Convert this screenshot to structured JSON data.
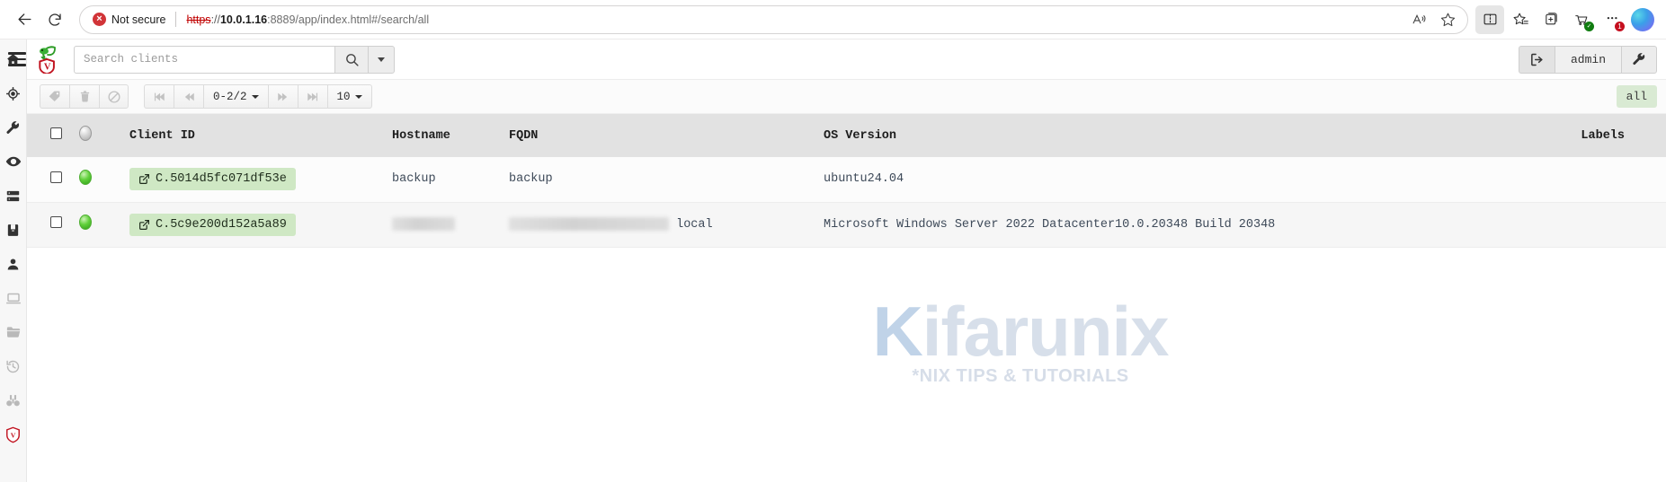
{
  "browser": {
    "back_label": "Back",
    "reload_label": "Refresh",
    "security_badge": "Not secure",
    "security_icon_glyph": "×",
    "url": {
      "scheme": "https",
      "separator": "://",
      "host": "10.0.1.16",
      "rest": ":8889/app/index.html#/search/all"
    },
    "omni_icons": [
      "read-aloud-icon",
      "favorite-star-icon"
    ],
    "toolbar_icons": [
      "split-screen-icon",
      "favorites-icon",
      "collections-icon",
      "shopping-icon",
      "settings-more-icon",
      "copilot-icon"
    ],
    "settings_badge": "1"
  },
  "sidebar": {
    "items": [
      {
        "name": "home-icon",
        "label": "Home",
        "dim": false
      },
      {
        "name": "hunt-target-icon",
        "label": "Hunt Manager",
        "dim": false
      },
      {
        "name": "wrench-icon",
        "label": "Artifacts",
        "dim": false
      },
      {
        "name": "eye-icon",
        "label": "Notebooks View",
        "dim": false
      },
      {
        "name": "server-icon",
        "label": "Server Artifacts",
        "dim": false
      },
      {
        "name": "notebook-icon",
        "label": "Notebooks",
        "dim": false
      },
      {
        "name": "user-icon",
        "label": "Users",
        "dim": false
      },
      {
        "name": "laptop-icon",
        "label": "Host Information",
        "dim": true
      },
      {
        "name": "folder-icon",
        "label": "Virtual Filesystem",
        "dim": true
      },
      {
        "name": "history-clock-icon",
        "label": "Collected Artifacts",
        "dim": true
      },
      {
        "name": "binoculars-icon",
        "label": "Client Events",
        "dim": true
      },
      {
        "name": "velociraptor-shield-icon",
        "label": "Velociraptor",
        "dim": false
      }
    ]
  },
  "header": {
    "menu_label": "Toggle navigation",
    "logo_label": "Velociraptor",
    "search": {
      "placeholder": "Search clients",
      "value": "",
      "button_icon": "search-icon",
      "dropdown_icon": "chevron-down-icon"
    },
    "user": {
      "logout_icon": "logout-icon",
      "username": "admin",
      "settings_icon": "wrench-icon"
    }
  },
  "toolbar": {
    "actions": [
      {
        "name": "label-clients-button",
        "icon": "tag-icon",
        "enabled": false
      },
      {
        "name": "delete-clients-button",
        "icon": "trash-icon",
        "enabled": false
      },
      {
        "name": "quarantine-button",
        "icon": "block-icon",
        "enabled": false
      }
    ],
    "pagination": [
      {
        "name": "first-page-button",
        "icon": "first-page-icon",
        "enabled": false
      },
      {
        "name": "prev-page-button",
        "icon": "prev-page-icon",
        "enabled": false
      }
    ],
    "page_range": "0-2/2",
    "pagination_after": [
      {
        "name": "next-page-button",
        "icon": "next-page-icon",
        "enabled": false
      },
      {
        "name": "last-page-button",
        "icon": "last-page-icon",
        "enabled": false
      }
    ],
    "page_size": "10",
    "filter_badge": "all"
  },
  "table": {
    "columns": [
      {
        "key": "select",
        "label": ""
      },
      {
        "key": "status",
        "label": ""
      },
      {
        "key": "client_id",
        "label": "Client ID"
      },
      {
        "key": "hostname",
        "label": "Hostname"
      },
      {
        "key": "fqdn",
        "label": "FQDN"
      },
      {
        "key": "os_version",
        "label": "OS Version"
      },
      {
        "key": "labels",
        "label": "Labels"
      }
    ],
    "rows": [
      {
        "selected": false,
        "status": "online",
        "client_id": "C.5014d5fc071df53e",
        "hostname": "backup",
        "hostname_redacted": false,
        "fqdn": "backup",
        "fqdn_redacted": false,
        "fqdn_suffix": "",
        "os_version": "ubuntu24.04",
        "labels": ""
      },
      {
        "selected": false,
        "status": "online",
        "client_id": "C.5c9e200d152a5a89",
        "hostname": "",
        "hostname_redacted": true,
        "fqdn": "",
        "fqdn_redacted": true,
        "fqdn_suffix": "local",
        "os_version": "Microsoft Windows Server 2022 Datacenter10.0.20348 Build 20348",
        "labels": ""
      }
    ]
  },
  "watermark": {
    "text_prefix": "K",
    "text_main": "ifarunix",
    "tagline": "*NIX TIPS & TUTORIALS"
  },
  "colors": {
    "accent_green": "#cfe8c4",
    "badge_green": "#d9ead3",
    "status_online": "#62d13c",
    "insecure_red": "#d13438"
  }
}
